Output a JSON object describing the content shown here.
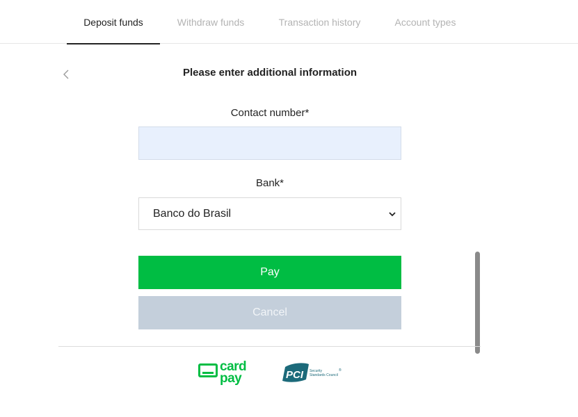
{
  "tabs": [
    {
      "label": "Deposit funds",
      "active": true
    },
    {
      "label": "Withdraw funds",
      "active": false
    },
    {
      "label": "Transaction history",
      "active": false
    },
    {
      "label": "Account types",
      "active": false
    }
  ],
  "form": {
    "title": "Please enter additional information",
    "contact_label": "Contact number*",
    "contact_value": "",
    "bank_label": "Bank*",
    "bank_selected": "Banco do Brasil"
  },
  "buttons": {
    "pay": "Pay",
    "cancel": "Cancel"
  },
  "footer": {
    "cardpay_line1": "card",
    "cardpay_line2": "pay",
    "pci_badge": "PCI",
    "pci_line1": "Security",
    "pci_line2": "Standards Council",
    "pci_reg": "®"
  },
  "colors": {
    "accent_green": "#00bd43",
    "cancel_gray": "#c4cfdb",
    "input_fill": "#e8f0fd",
    "pci_teal": "#1c6a7a"
  },
  "icons": {
    "back": "chevron-left-icon",
    "select": "chevron-down-icon"
  }
}
